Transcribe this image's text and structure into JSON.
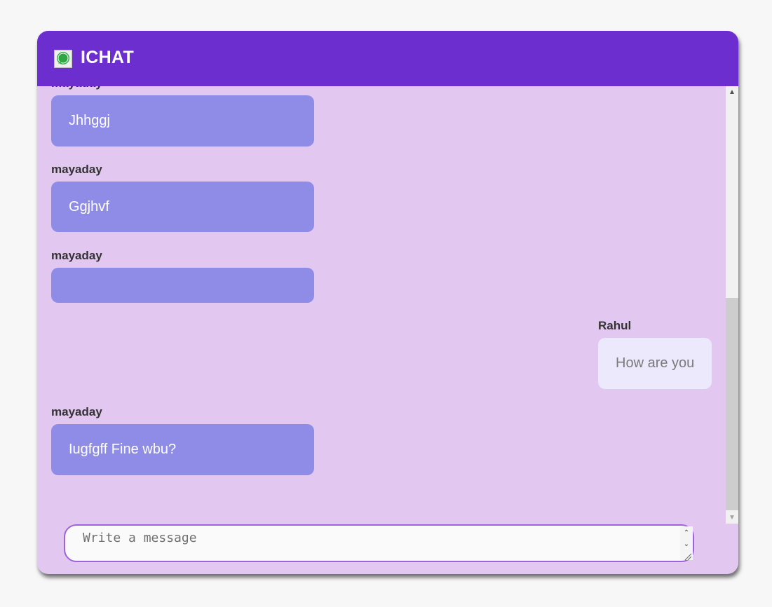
{
  "app": {
    "title": "ICHAT",
    "logo_icon": "chat-bubble-icon",
    "header_color": "#6c2ecf",
    "background_color": "#e2c7f0"
  },
  "messages": [
    {
      "sender": "mayaday",
      "text": "Jhhggj",
      "side": "left"
    },
    {
      "sender": "mayaday",
      "text": "Ggjhvf",
      "side": "left"
    },
    {
      "sender": "mayaday",
      "text": "",
      "side": "left"
    },
    {
      "sender": "Rahul",
      "text": "How are you",
      "side": "right"
    },
    {
      "sender": "mayaday",
      "text": "Iugfgff Fine wbu?",
      "side": "left"
    }
  ],
  "composer": {
    "placeholder": "Write a message"
  },
  "colors": {
    "incoming_bubble": "#8f8ce8",
    "outgoing_bubble": "#ebe9fb",
    "composer_border": "#9c63da"
  }
}
